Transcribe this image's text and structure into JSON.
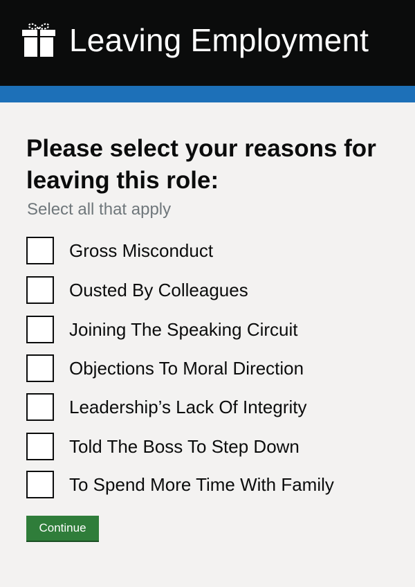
{
  "header": {
    "logo_icon": "gift-icon",
    "title": "Leaving Employment",
    "background": "#0b0c0c",
    "accent_bar": "#1d70b8"
  },
  "form": {
    "heading": "Please select your reasons for leaving this role:",
    "hint": "Select all that apply",
    "options": [
      {
        "label": "Gross Misconduct",
        "checked": false
      },
      {
        "label": "Ousted By Colleagues",
        "checked": false
      },
      {
        "label": "Joining The Speaking Circuit",
        "checked": false
      },
      {
        "label": "Objections To Moral Direction",
        "checked": false
      },
      {
        "label": "Leadership’s Lack Of Integrity",
        "checked": false
      },
      {
        "label": "Told The Boss To Step Down",
        "checked": false
      },
      {
        "label": "To Spend More Time With Family",
        "checked": false
      }
    ],
    "continue_label": "Continue",
    "continue_color": "#2f7d3a"
  }
}
